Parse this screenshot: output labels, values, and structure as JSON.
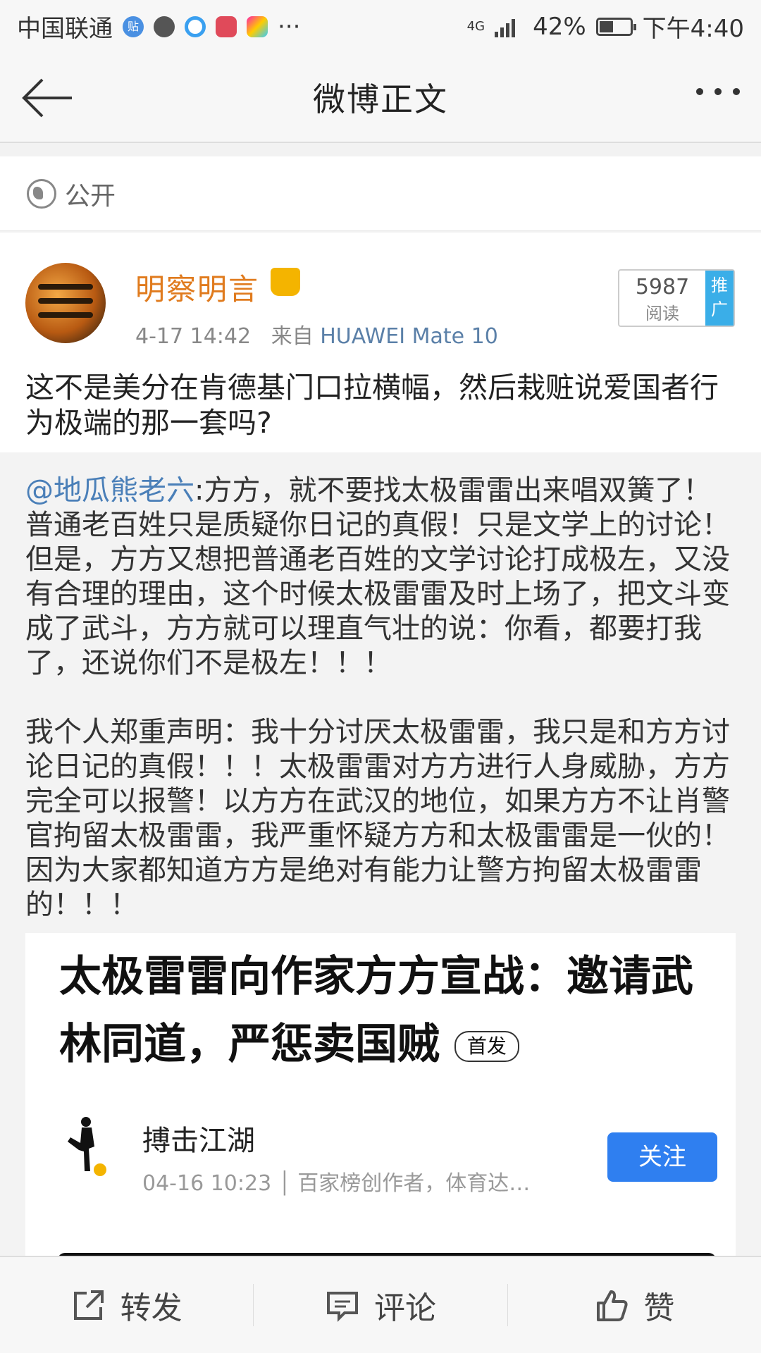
{
  "status_bar": {
    "carrier": "中国联通",
    "tieba_badge": "贴",
    "more": "···",
    "network": "4G",
    "battery": "42%",
    "time": "下午4:40"
  },
  "nav": {
    "title": "微博正文"
  },
  "visibility": {
    "label": "公开"
  },
  "post": {
    "username": "明察明言",
    "timestamp": "4-17 14:42",
    "source_prefix": "来自",
    "source": "HUAWEI Mate 10",
    "reads_count": "5987",
    "reads_label": "阅读",
    "promo_label": "推广",
    "text": "这不是美分在肯德基门口拉横幅，然后栽赃说爱国者行为极端的那一套吗?"
  },
  "repost": {
    "mention": "@地瓜熊老六",
    "text": ":方方，就不要找太极雷雷出来唱双簧了！普通老百姓只是质疑你日记的真假！只是文学上的讨论！但是，方方又想把普通老百姓的文学讨论打成极左，又没有合理的理由，这个时候太极雷雷及时上场了，把文斗变成了武斗，方方就可以理直气壮的说：你看，都要打我了，还说你们不是极左！！！\n\n我个人郑重声明：我十分讨厌太极雷雷，我只是和方方讨论日记的真假！！！太极雷雷对方方进行人身威胁，方方完全可以报警！以方方在武汉的地位，如果方方不让肖警官拘留太极雷雷，我严重怀疑方方和太极雷雷是一伙的！因为大家都知道方方是绝对有能力让警方拘留太极雷雷的！！！"
  },
  "embed": {
    "title": "太极雷雷向作家方方宣战：邀请武林同道，严惩卖国贼",
    "tag": "首发",
    "author_name": "搏击江湖",
    "author_meta": "04-16 10:23 │ 百家榜创作者，体育达…",
    "follow_label": "关注"
  },
  "toolbar": {
    "repost": "转发",
    "comment": "评论",
    "like": "赞"
  },
  "colors": {
    "username": "#e07b1e",
    "mention": "#4a7fb8",
    "follow": "#2f7ff0",
    "promo": "#3aaee8"
  }
}
